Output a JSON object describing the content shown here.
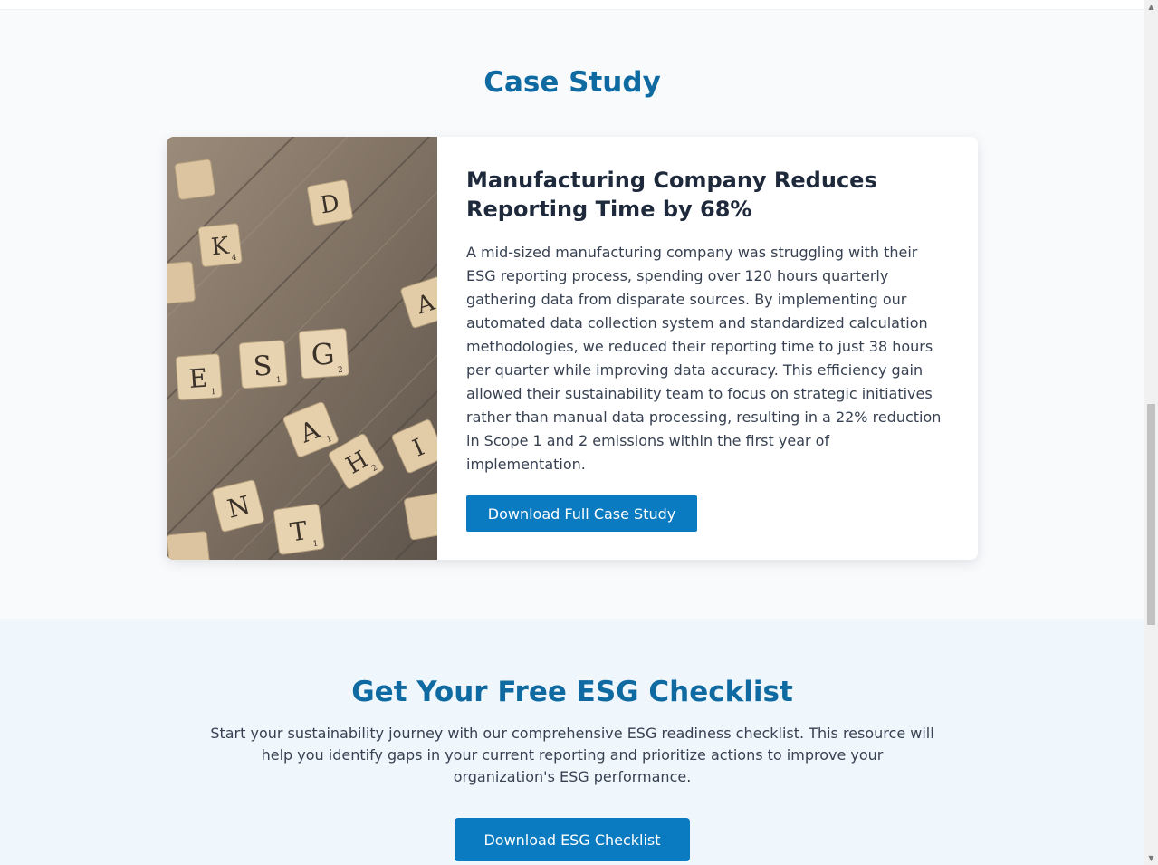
{
  "case_study": {
    "section_title": "Case Study",
    "card": {
      "image_tiles": {
        "top_left": [
          "K",
          "D"
        ],
        "esg_word": [
          "E",
          "S",
          "G"
        ],
        "right_tile": "A",
        "bottom": [
          "A",
          "H",
          "N",
          "T",
          "I"
        ],
        "subscripts": [
          "4",
          "1",
          "1",
          "2",
          "1",
          "2",
          "1"
        ]
      },
      "heading": "Manufacturing Company Reduces Reporting Time by 68%",
      "body": "A mid-sized manufacturing company was struggling with their ESG reporting process, spending over 120 hours quarterly gathering data from disparate sources. By implementing our automated data collection system and standardized calculation methodologies, we reduced their reporting time to just 38 hours per quarter while improving data accuracy. This efficiency gain allowed their sustainability team to focus on strategic initiatives rather than manual data processing, resulting in a 22% reduction in Scope 1 and 2 emissions within the first year of implementation.",
      "button_label": "Download Full Case Study"
    }
  },
  "checklist": {
    "title": "Get Your Free ESG Checklist",
    "description": "Start your sustainability journey with our comprehensive ESG readiness checklist. This resource will help you identify gaps in your current reporting and prioritize actions to improve your organization's ESG performance.",
    "button_label": "Download ESG Checklist"
  },
  "colors": {
    "accent": "#0f6aa1",
    "button": "#0b7bc1",
    "section_bg": "#f8fafc",
    "checklist_bg": "#eff7fd"
  },
  "scrollbar": {
    "up_icon": "arrow-up-icon",
    "down_icon": "arrow-down-icon",
    "up_glyph": "▲",
    "down_glyph": "▼"
  }
}
